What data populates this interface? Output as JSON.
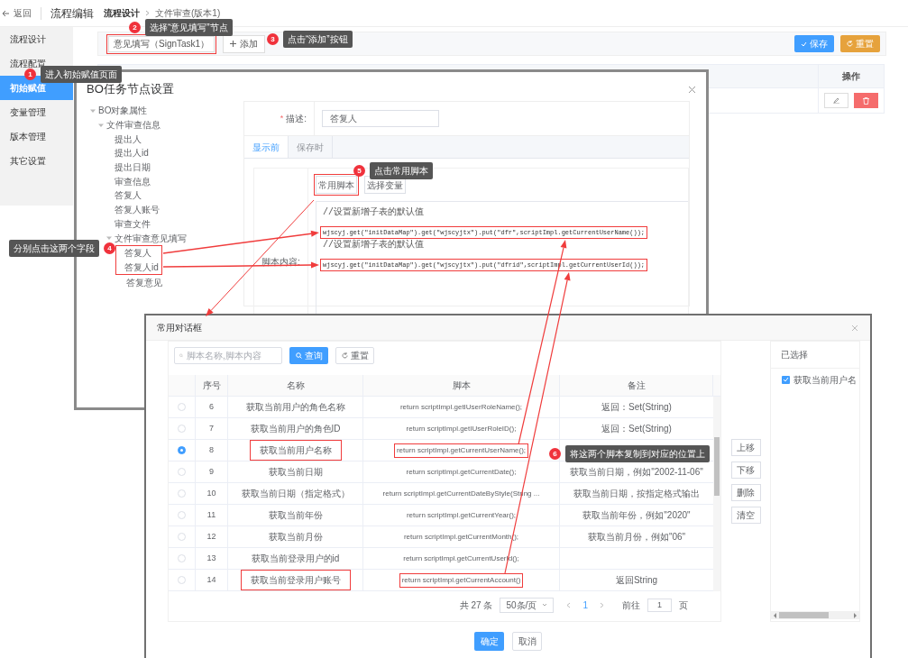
{
  "header": {
    "back": "返回",
    "title": "流程编辑"
  },
  "breadcrumb": [
    "流程设计",
    "文件审查(版本1)"
  ],
  "sidebar": {
    "items": [
      {
        "label": "流程设计",
        "selected": false
      },
      {
        "label": "流程配置",
        "selected": false
      },
      {
        "label": "初始赋值",
        "selected": true
      },
      {
        "label": "变量管理",
        "selected": false
      },
      {
        "label": "版本管理",
        "selected": false
      },
      {
        "label": "其它设置",
        "selected": false
      }
    ]
  },
  "toolbar": {
    "node_select": "意见填写（SignTask1）",
    "add_button": "添加",
    "save_button": "保存",
    "reset_button": "重置"
  },
  "table": {
    "columns": [
      "操作"
    ]
  },
  "bo_dialog": {
    "title": "BO任务节点设置",
    "tree": [
      {
        "label": "BO对象属性",
        "expanded": true,
        "children": [
          {
            "label": "文件审查信息",
            "expanded": true,
            "children": [
              {
                "label": "提出人"
              },
              {
                "label": "提出人id"
              },
              {
                "label": "提出日期"
              },
              {
                "label": "审查信息"
              },
              {
                "label": "答复人"
              },
              {
                "label": "答复人账号"
              },
              {
                "label": "审查文件"
              },
              {
                "label": "文件审查意见填写",
                "expanded": true,
                "children": [
                  {
                    "label": "答复人"
                  },
                  {
                    "label": "答复人id"
                  },
                  {
                    "label": "答复意见"
                  }
                ]
              }
            ]
          }
        ]
      }
    ],
    "required_mark": "*",
    "description_label": "描述:",
    "description_value": "答复人",
    "tabs": [
      {
        "label": "显示前",
        "selected": true
      },
      {
        "label": "保存时",
        "selected": false
      }
    ],
    "script_buttons": [
      "常用脚本",
      "选择变量"
    ],
    "script_label": "脚本内容:",
    "code_lines": [
      {
        "kind": "comment",
        "text": "//设置新增子表的默认值"
      },
      {
        "kind": "code",
        "text": "wjscyj.get(\"initDataMap\").get(\"wjscyjtx\").put(\"dfr\",scriptImpl.getCurrentUserName());"
      },
      {
        "kind": "comment",
        "text": "//设置新增子表的默认值"
      },
      {
        "kind": "code",
        "text": "wjscyj.get(\"initDataMap\").get(\"wjscyjtx\").put(\"dfrid\",scriptImpl.getCurrentUserId());"
      }
    ]
  },
  "script_dialog": {
    "title": "常用对话框",
    "search_placeholder": "脚本名称,脚本内容",
    "search_button": "查询",
    "reset_button": "重置",
    "columns": [
      "序号",
      "名称",
      "脚本",
      "备注"
    ],
    "rows": [
      {
        "selected": false,
        "index": "6",
        "name": "获取当前用户的角色名称",
        "script": "return scriptImpl.getIUserRoleName();",
        "note": "返回：Set(String)"
      },
      {
        "selected": false,
        "index": "7",
        "name": "获取当前用户的角色ID",
        "script": "return scriptImpl.getIUserRoleID();",
        "note": "返回：Set(String)"
      },
      {
        "selected": true,
        "index": "8",
        "name": "获取当前用户名称",
        "script": "return scriptImpl.getCurrentUserName();"
      },
      {
        "selected": false,
        "index": "9",
        "name": "获取当前日期",
        "script": "return scriptImpl.getCurrentDate();",
        "note": "获取当前日期，例如\"2002-11-06\""
      },
      {
        "selected": false,
        "index": "10",
        "name": "获取当前日期（指定格式）",
        "script": "return scriptImpl.getCurrentDateByStyle(String ...",
        "note": "获取当前日期，按指定格式输出"
      },
      {
        "selected": false,
        "index": "11",
        "name": "获取当前年份",
        "script": "return scriptImpl.getCurrentYear();",
        "note": "获取当前年份，例如\"2020\""
      },
      {
        "selected": false,
        "index": "12",
        "name": "获取当前月份",
        "script": "return scriptImpl.getCurrentMonth();",
        "note": "获取当前月份，例如\"06\""
      },
      {
        "selected": false,
        "index": "13",
        "name": "获取当前登录用户的id",
        "script": "return scriptImpl.getCurrentUserId();"
      },
      {
        "selected": false,
        "index": "14",
        "name": "获取当前登录用户账号",
        "script": "return scriptImpl.getCurrentAccount()",
        "note": "返回String"
      }
    ],
    "pagination": {
      "total": "共 27 条",
      "page_size": "50条/页",
      "current_page": "1",
      "goto_label": "前往",
      "goto_value": "1",
      "page_unit": "页"
    },
    "side_buttons": [
      "上移",
      "下移",
      "删除",
      "清空"
    ],
    "selected_panel": {
      "title": "已选择",
      "items": [
        {
          "label": "获取当前用户名",
          "checked": true
        }
      ]
    },
    "footer_buttons": [
      "确定",
      "取消"
    ]
  },
  "annotations": [
    {
      "number": "1",
      "text": "进入初始赋值页面"
    },
    {
      "number": "2",
      "text": "选择“意见填写”节点"
    },
    {
      "number": "3",
      "text": "点击“添加”按钮"
    },
    {
      "number": "4",
      "text": "分别点击这两个字段"
    },
    {
      "number": "5",
      "text": "点击常用脚本"
    },
    {
      "number": "6",
      "text": "将这两个脚本复制到对应的位置上"
    }
  ]
}
